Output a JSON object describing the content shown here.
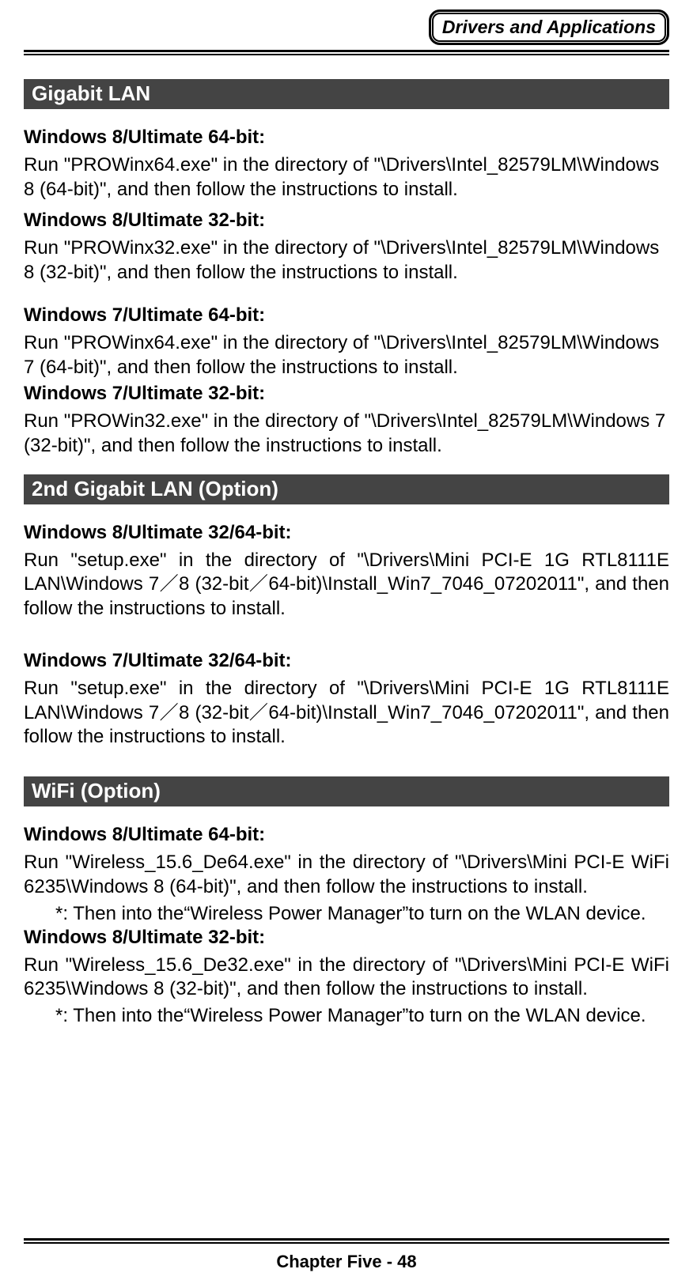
{
  "header": {
    "title": "Drivers and Applications"
  },
  "sections": {
    "s1": {
      "title": "Gigabit LAN",
      "items": {
        "a": {
          "head": "Windows 8/Ultimate 64-bit:",
          "body": "Run \"PROWinx64.exe\" in the directory of \"\\Drivers\\Intel_82579LM\\Windows 8 (64-bit)\", and then follow the instructions to install."
        },
        "b": {
          "head": "Windows 8/Ultimate 32-bit:",
          "body": "Run \"PROWinx32.exe\" in the directory of \"\\Drivers\\Intel_82579LM\\Windows 8 (32-bit)\", and then follow the instructions to install."
        },
        "c": {
          "head": "Windows 7/Ultimate 64-bit:",
          "body": "Run \"PROWinx64.exe\" in the directory of \"\\Drivers\\Intel_82579LM\\Windows 7 (64-bit)\", and then follow the instructions to install."
        },
        "d": {
          "head": "Windows 7/Ultimate 32-bit:",
          "body": "Run \"PROWin32.exe\" in the directory of \"\\Drivers\\Intel_82579LM\\Windows 7 (32-bit)\", and then follow the instructions to install."
        }
      }
    },
    "s2": {
      "title": "2nd Gigabit LAN (Option)",
      "items": {
        "a": {
          "head": "Windows 8/Ultimate 32/64-bit:",
          "body": "Run \"setup.exe\" in the directory of \"\\Drivers\\Mini PCI-E 1G RTL8111E LAN\\Windows 7／8 (32-bit／64-bit)\\Install_Win7_7046_07202011\", and then follow the instructions to install."
        },
        "b": {
          "head": "Windows 7/Ultimate 32/64-bit:",
          "body": "Run \"setup.exe\" in the directory of \"\\Drivers\\Mini PCI-E 1G RTL8111E LAN\\Windows 7／8 (32-bit／64-bit)\\Install_Win7_7046_07202011\", and then follow the instructions to install."
        }
      }
    },
    "s3": {
      "title": "WiFi (Option)",
      "items": {
        "a": {
          "head": "Windows 8/Ultimate 64-bit:",
          "body": "Run \"Wireless_15.6_De64.exe\" in the directory of \"\\Drivers\\Mini PCI-E WiFi 6235\\Windows 8 (64-bit)\", and then follow the instructions to install.",
          "note": "*: Then into the“Wireless Power Manager”to turn on the WLAN device."
        },
        "b": {
          "head": "Windows 8/Ultimate 32-bit:",
          "body": "Run \"Wireless_15.6_De32.exe\" in the directory of \"\\Drivers\\Mini PCI-E WiFi 6235\\Windows 8 (32-bit)\", and then follow the instructions to install.",
          "note": "*: Then into the“Wireless Power Manager”to turn on the WLAN device."
        }
      }
    }
  },
  "footer": {
    "text": "Chapter Five - 48"
  }
}
